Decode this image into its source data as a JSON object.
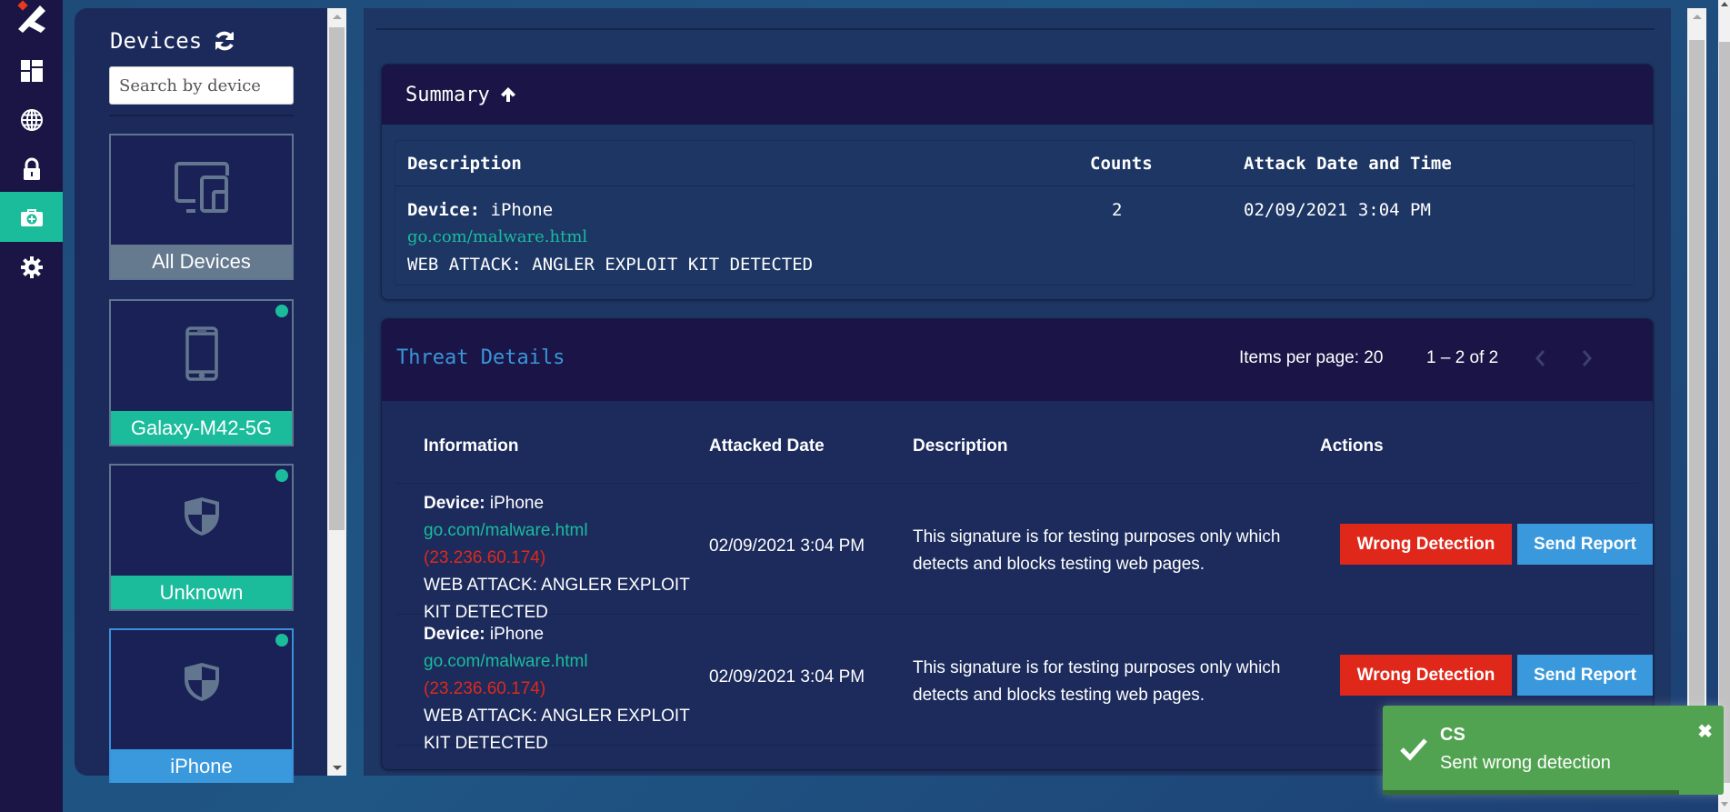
{
  "nav": {
    "items": [
      {
        "name": "dashboard",
        "active": false
      },
      {
        "name": "globe",
        "active": false
      },
      {
        "name": "lock",
        "active": false
      },
      {
        "name": "medical-kit",
        "active": true
      },
      {
        "name": "settings",
        "active": false
      }
    ]
  },
  "devices": {
    "title": "Devices",
    "search_placeholder": "Search by device",
    "cards": [
      {
        "label": "All Devices",
        "icon": "devices-icon",
        "status_dot": false,
        "label_color": "#65798f",
        "selected": false
      },
      {
        "label": "Galaxy-M42-5G",
        "icon": "phone-icon",
        "status_dot": true,
        "label_color": "#1abc9c",
        "selected": false
      },
      {
        "label": "Unknown",
        "icon": "shield-icon",
        "status_dot": true,
        "label_color": "#1abc9c",
        "selected": false
      },
      {
        "label": "iPhone",
        "icon": "shield-icon",
        "status_dot": true,
        "label_color": "#3a98dc",
        "selected": true
      }
    ]
  },
  "summary": {
    "title": "Summary",
    "headers": {
      "description": "Description",
      "counts": "Counts",
      "date": "Attack Date and Time"
    },
    "row": {
      "device_label": "Device:",
      "device": "iPhone",
      "url": "go.com/malware.html",
      "attack": "WEB ATTACK: ANGLER EXPLOIT KIT DETECTED",
      "counts": "2",
      "date": "02/09/2021 3:04 PM"
    }
  },
  "threats": {
    "title": "Threat Details",
    "items_per_page": "Items per page: 20",
    "range": "1 – 2 of 2",
    "headers": {
      "information": "Information",
      "date": "Attacked Date",
      "description": "Description",
      "actions": "Actions"
    },
    "rows": [
      {
        "device_label": "Device:",
        "device": "iPhone",
        "url": "go.com/malware.html",
        "ip": "(23.236.60.174)",
        "attack": "WEB ATTACK: ANGLER EXPLOIT KIT DETECTED",
        "date": "02/09/2021 3:04 PM",
        "description": "This signature is for testing purposes only which detects and blocks testing web pages.",
        "wrong_label": "Wrong Detection",
        "report_label": "Send Report"
      },
      {
        "device_label": "Device:",
        "device": "iPhone",
        "url": "go.com/malware.html",
        "ip": "(23.236.60.174)",
        "attack": "WEB ATTACK: ANGLER EXPLOIT KIT DETECTED",
        "date": "02/09/2021 3:04 PM",
        "description": "This signature is for testing purposes only which detects and blocks testing web pages.",
        "wrong_label": "Wrong Detection",
        "report_label": "Send Report"
      }
    ]
  },
  "toast": {
    "title": "CS",
    "message": "Sent wrong detection",
    "close": "✖",
    "progress": 0.87
  },
  "colors": {
    "accent_teal": "#1abc9c",
    "accent_blue": "#3a98dc",
    "danger": "#e0281a",
    "success": "#51a351"
  }
}
